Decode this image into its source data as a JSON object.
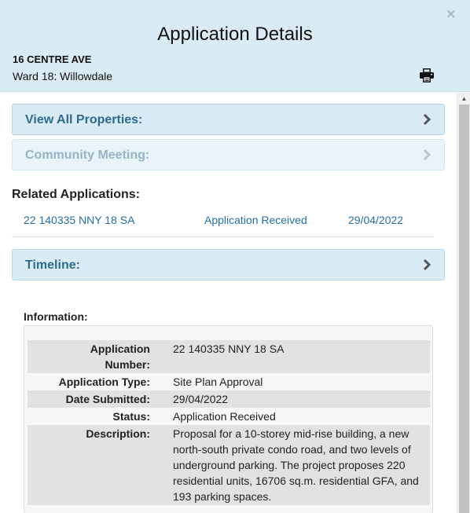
{
  "dialog": {
    "title": "Application Details",
    "close_glyph": "×",
    "address": "16 CENTRE AVE",
    "ward": "Ward 18: Willowdale"
  },
  "icons": {
    "print": "printer-icon",
    "close": "close-icon",
    "chevron": "chevron-right-icon"
  },
  "panels": {
    "properties": {
      "label": "View All Properties:"
    },
    "community": {
      "label": "Community Meeting:"
    },
    "timeline": {
      "label": "Timeline:"
    }
  },
  "related": {
    "heading": "Related Applications:",
    "rows": [
      {
        "number": "22 140335 NNY 18 SA",
        "status": "Application Received",
        "date": "29/04/2022"
      }
    ]
  },
  "information": {
    "heading": "Information:",
    "fields": [
      {
        "label": "Application Number:",
        "value": "22 140335 NNY 18 SA"
      },
      {
        "label": "Application Type:",
        "value": "Site Plan Approval"
      },
      {
        "label": "Date Submitted:",
        "value": "29/04/2022"
      },
      {
        "label": "Status:",
        "value": "Application Received"
      },
      {
        "label": "Description:",
        "value": "Proposal for a 10-storey mid-rise building, a new north-south private condo road, and two levels of underground parking. The project proposes 220 residential units, 16706 sq.m. residential GFA, and 193 parking spaces."
      }
    ]
  },
  "colors": {
    "header_bg": "#d9ecf6",
    "link": "#2670a6",
    "panel_text": "#2d6b8e"
  }
}
